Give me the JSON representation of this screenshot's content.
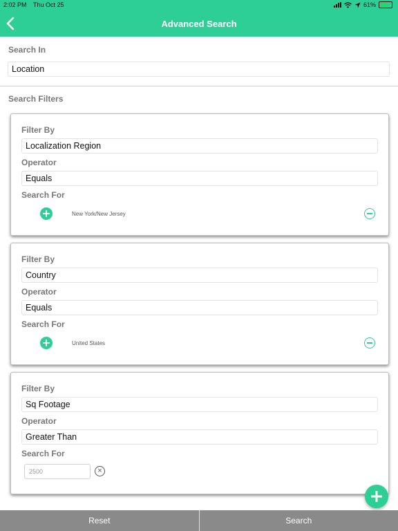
{
  "status_bar": {
    "time": "2:02 PM",
    "date": "Thu Oct 25",
    "battery": "61%"
  },
  "header": {
    "title": "Advanced Search",
    "back_icon": "chevron-left-icon"
  },
  "search_in": {
    "label": "Search In",
    "value": "Location"
  },
  "filters_label": "Search Filters",
  "filters": [
    {
      "filter_by_label": "Filter By",
      "filter_by": "Localization Region",
      "operator_label": "Operator",
      "operator": "Equals",
      "search_for_label": "Search For",
      "search_for": "New York/New Jersey"
    },
    {
      "filter_by_label": "Filter By",
      "filter_by": "Country",
      "operator_label": "Operator",
      "operator": "Equals",
      "search_for_label": "Search For",
      "search_for": "United States"
    },
    {
      "filter_by_label": "Filter By",
      "filter_by": "Sq Footage",
      "operator_label": "Operator",
      "operator": "Greater Than",
      "search_for_label": "Search For",
      "search_for_placeholder": "2500"
    }
  ],
  "footer": {
    "reset_label": "Reset",
    "search_label": "Search"
  },
  "colors": {
    "accent": "#2ecf96",
    "footer": "#8a8a8a"
  }
}
